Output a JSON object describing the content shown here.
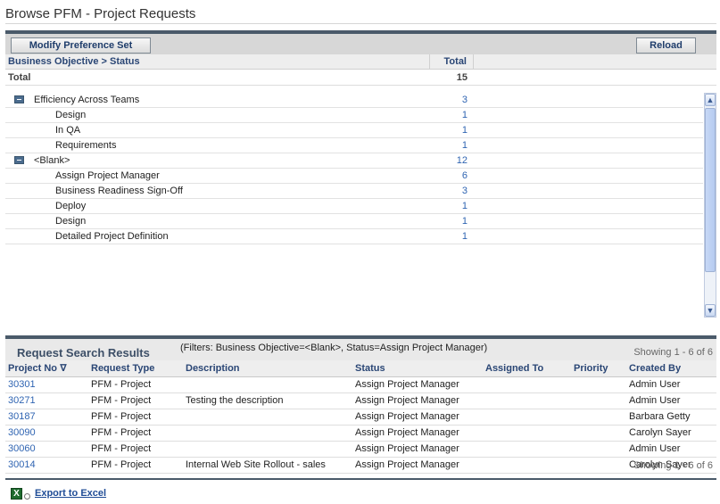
{
  "page": {
    "title": "Browse PFM - Project Requests"
  },
  "toolbar": {
    "modify_label": "Modify Preference Set",
    "reload_label": "Reload"
  },
  "summary_grid": {
    "col_group": "Business Objective > Status",
    "col_total": "Total",
    "total_label": "Total",
    "total_value": "15",
    "rows": [
      {
        "label": "Efficiency Across Teams",
        "value": "3",
        "level": 0,
        "expanded": true
      },
      {
        "label": "Design",
        "value": "1",
        "level": 1
      },
      {
        "label": "In QA",
        "value": "1",
        "level": 1
      },
      {
        "label": "Requirements",
        "value": "1",
        "level": 1
      },
      {
        "label": "<Blank>",
        "value": "12",
        "level": 0,
        "expanded": true
      },
      {
        "label": "Assign Project Manager",
        "value": "6",
        "level": 1
      },
      {
        "label": "Business Readiness Sign-Off",
        "value": "3",
        "level": 1
      },
      {
        "label": "Deploy",
        "value": "1",
        "level": 1
      },
      {
        "label": "Design",
        "value": "1",
        "level": 1
      },
      {
        "label": "Detailed Project Definition",
        "value": "1",
        "level": 1
      }
    ]
  },
  "results": {
    "title": "Request Search Results",
    "filter_text": "(Filters: Business Objective=<Blank>, Status=Assign Project Manager)",
    "showing_top": "Showing 1 - 6 of 6",
    "showing_bottom": "Showing 1 - 6 of 6",
    "columns": [
      "Project No ∇",
      "Request Type",
      "Description",
      "Status",
      "Assigned To",
      "Priority",
      "Created By"
    ],
    "rows": [
      [
        "30301",
        "PFM - Project",
        "",
        "Assign Project Manager",
        "",
        "",
        "Admin User"
      ],
      [
        "30271",
        "PFM - Project",
        "Testing the description",
        "Assign Project Manager",
        "",
        "",
        "Admin User"
      ],
      [
        "30187",
        "PFM - Project",
        "",
        "Assign Project Manager",
        "",
        "",
        "Barbara Getty"
      ],
      [
        "30090",
        "PFM - Project",
        "",
        "Assign Project Manager",
        "",
        "",
        "Carolyn Sayer"
      ],
      [
        "30060",
        "PFM - Project",
        "",
        "Assign Project Manager",
        "",
        "",
        "Admin User"
      ],
      [
        "30014",
        "PFM - Project",
        "Internal Web Site Rollout - sales",
        "Assign Project Manager",
        "",
        "",
        "Carolyn Sayer"
      ]
    ]
  },
  "footer": {
    "export_label": "Export to Excel",
    "excel_icon": "excel-icon"
  },
  "colors": {
    "link": "#2f64b2",
    "header_text": "#2a4675",
    "panel_border": "#4a5a6a"
  }
}
